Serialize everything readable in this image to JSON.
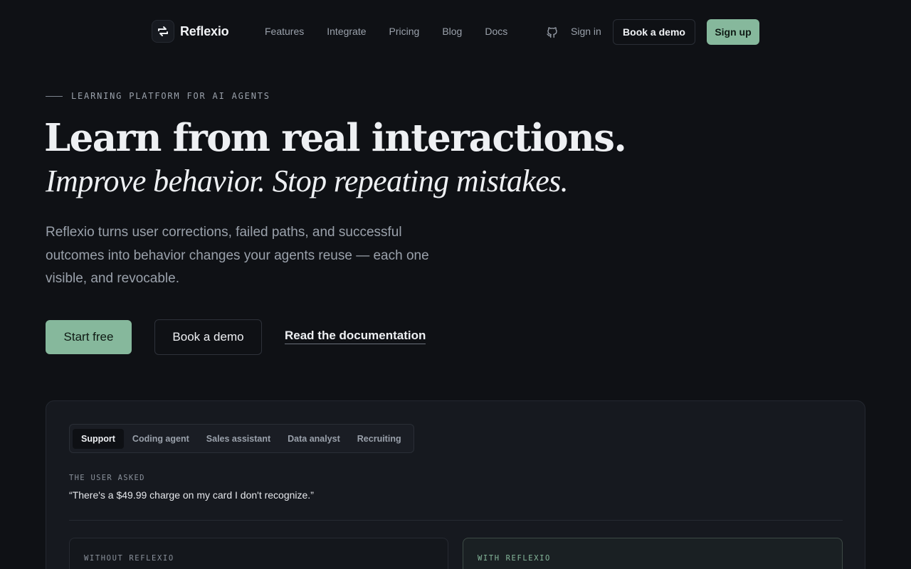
{
  "brand": {
    "name": "Reflexio",
    "logo_icon": "reflexio-logo-icon"
  },
  "nav": {
    "links": [
      "Features",
      "Integrate",
      "Pricing",
      "Blog",
      "Docs"
    ],
    "github_icon": "github-icon",
    "signin": "Sign in",
    "book_demo": "Book a demo",
    "signup": "Sign up"
  },
  "hero": {
    "eyebrow": "LEARNING PLATFORM FOR AI AGENTS",
    "title": "Learn from real interactions.",
    "subtitle": "Improve behavior. Stop repeating mistakes.",
    "lede": "Reflexio turns user corrections, failed paths, and successful outcomes into behavior changes your agents reuse — each one visible, and revocable.",
    "cta_start": "Start free",
    "cta_demo": "Book a demo",
    "cta_docs": "Read the documentation"
  },
  "demo": {
    "tabs": [
      "Support",
      "Coding agent",
      "Sales assistant",
      "Data analyst",
      "Recruiting"
    ],
    "active_tab": "Support",
    "asked_label": "THE USER ASKED",
    "asked_quote": "“There's a $49.99 charge on my card I don't recognize.”",
    "without_label": "WITHOUT REFLEXIO",
    "with_label": "WITH REFLEXIO"
  },
  "colors": {
    "background": "#0f1115",
    "accent": "#86b89c",
    "card": "#16191f"
  }
}
